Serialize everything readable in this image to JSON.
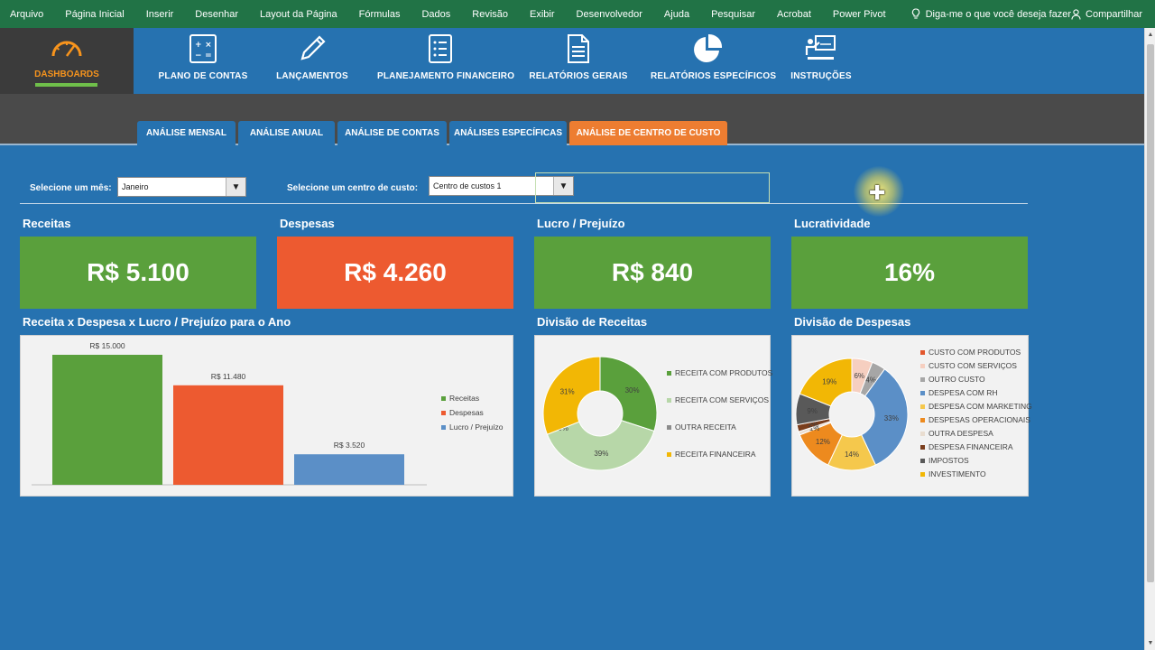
{
  "ribbon": {
    "items": [
      "Arquivo",
      "Página Inicial",
      "Inserir",
      "Desenhar",
      "Layout da Página",
      "Fórmulas",
      "Dados",
      "Revisão",
      "Exibir",
      "Desenvolvedor",
      "Ajuda",
      "Pesquisar",
      "Acrobat",
      "Power Pivot"
    ],
    "tell_me": "Diga-me o que você deseja fazer",
    "share": "Compartilhar"
  },
  "nav": {
    "dashboards": "DASHBOARDS",
    "items": [
      {
        "label": "PLANO DE CONTAS",
        "icon": "calculator-icon"
      },
      {
        "label": "LANÇAMENTOS",
        "icon": "pencil-icon"
      },
      {
        "label": "PLANEJAMENTO FINANCEIRO",
        "icon": "checklist-icon"
      },
      {
        "label": "RELATÓRIOS GERAIS",
        "icon": "document-icon"
      },
      {
        "label": "RELATÓRIOS ESPECÍFICOS",
        "icon": "pie-chart-icon"
      },
      {
        "label": "INSTRUÇÕES",
        "icon": "presenter-icon"
      }
    ]
  },
  "tabs": [
    "ANÁLISE MENSAL",
    "ANÁLISE ANUAL",
    "ANÁLISE DE CONTAS",
    "ANÁLISES ESPECÍFICAS",
    "ANÁLISE DE CENTRO DE CUSTO"
  ],
  "active_tab": "ANÁLISE DE CENTRO DE CUSTO",
  "filters": {
    "month_label": "Selecione um mês:",
    "month_value": "Janeiro",
    "cost_center_label": "Selecione um centro de custo:",
    "cost_center_value": "Centro de custos 1"
  },
  "kpis": [
    {
      "title": "Receitas",
      "value": "R$ 5.100",
      "color": "#5aa03c"
    },
    {
      "title": "Despesas",
      "value": "R$ 4.260",
      "color": "#ed5a30"
    },
    {
      "title": "Lucro / Prejuízo",
      "value": "R$ 840",
      "color": "#5aa03c"
    },
    {
      "title": "Lucratividade",
      "value": "16%",
      "color": "#5aa03c"
    }
  ],
  "charts_titles": {
    "bar": "Receita x Despesa x Lucro / Prejuízo para o Ano",
    "receitas": "Divisão de Receitas",
    "despesas": "Divisão de Despesas"
  },
  "chart_data": [
    {
      "type": "bar",
      "title": "Receita x Despesa x Lucro / Prejuízo para o Ano",
      "categories": [
        "Receitas",
        "Despesas",
        "Lucro / Prejuízo"
      ],
      "values": [
        15000,
        11480,
        3520
      ],
      "data_labels": [
        "R$ 15.000",
        "R$ 11.480",
        "R$ 3.520"
      ],
      "colors": [
        "#5aa03c",
        "#ed5a30",
        "#5b8fc7"
      ],
      "legend": "right",
      "ylim": [
        0,
        15000
      ],
      "grid": false
    },
    {
      "type": "pie",
      "title": "Divisão de Receitas",
      "donut": true,
      "labels": [
        "RECEITA COM PRODUTOS",
        "RECEITA COM SERVIÇOS",
        "OUTRA RECEITA",
        "RECEITA FINANCEIRA"
      ],
      "values": [
        30,
        39,
        0,
        31
      ],
      "data_labels": [
        "30%",
        "39%",
        "0%",
        "31%"
      ],
      "colors": [
        "#5aa03c",
        "#b7d7a8",
        "#8c8c8c",
        "#f2b705"
      ],
      "legend": "right"
    },
    {
      "type": "pie",
      "title": "Divisão de Despesas",
      "donut": true,
      "labels": [
        "CUSTO COM PRODUTOS",
        "CUSTO COM SERVIÇOS",
        "OUTRO CUSTO",
        "DESPESA COM RH",
        "DESPESA COM MARKETING",
        "DESPESAS OPERACIONAIS",
        "OUTRA DESPESA",
        "DESPESA FINANCEIRA",
        "IMPOSTOS",
        "INVESTIMENTO"
      ],
      "values": [
        0,
        6,
        4,
        33,
        14,
        12,
        1,
        2,
        9,
        19
      ],
      "data_labels": [
        "0%",
        "6%",
        "4%",
        "33%",
        "14%",
        "12%",
        "1%",
        "2%",
        "9%",
        "19%"
      ],
      "colors": [
        "#e2572d",
        "#f6cfc0",
        "#a6a6a6",
        "#5b8fc7",
        "#f5c84c",
        "#ed8a1e",
        "#e9ddd0",
        "#7a3e1d",
        "#595959",
        "#f2b705"
      ],
      "legend": "right"
    }
  ]
}
